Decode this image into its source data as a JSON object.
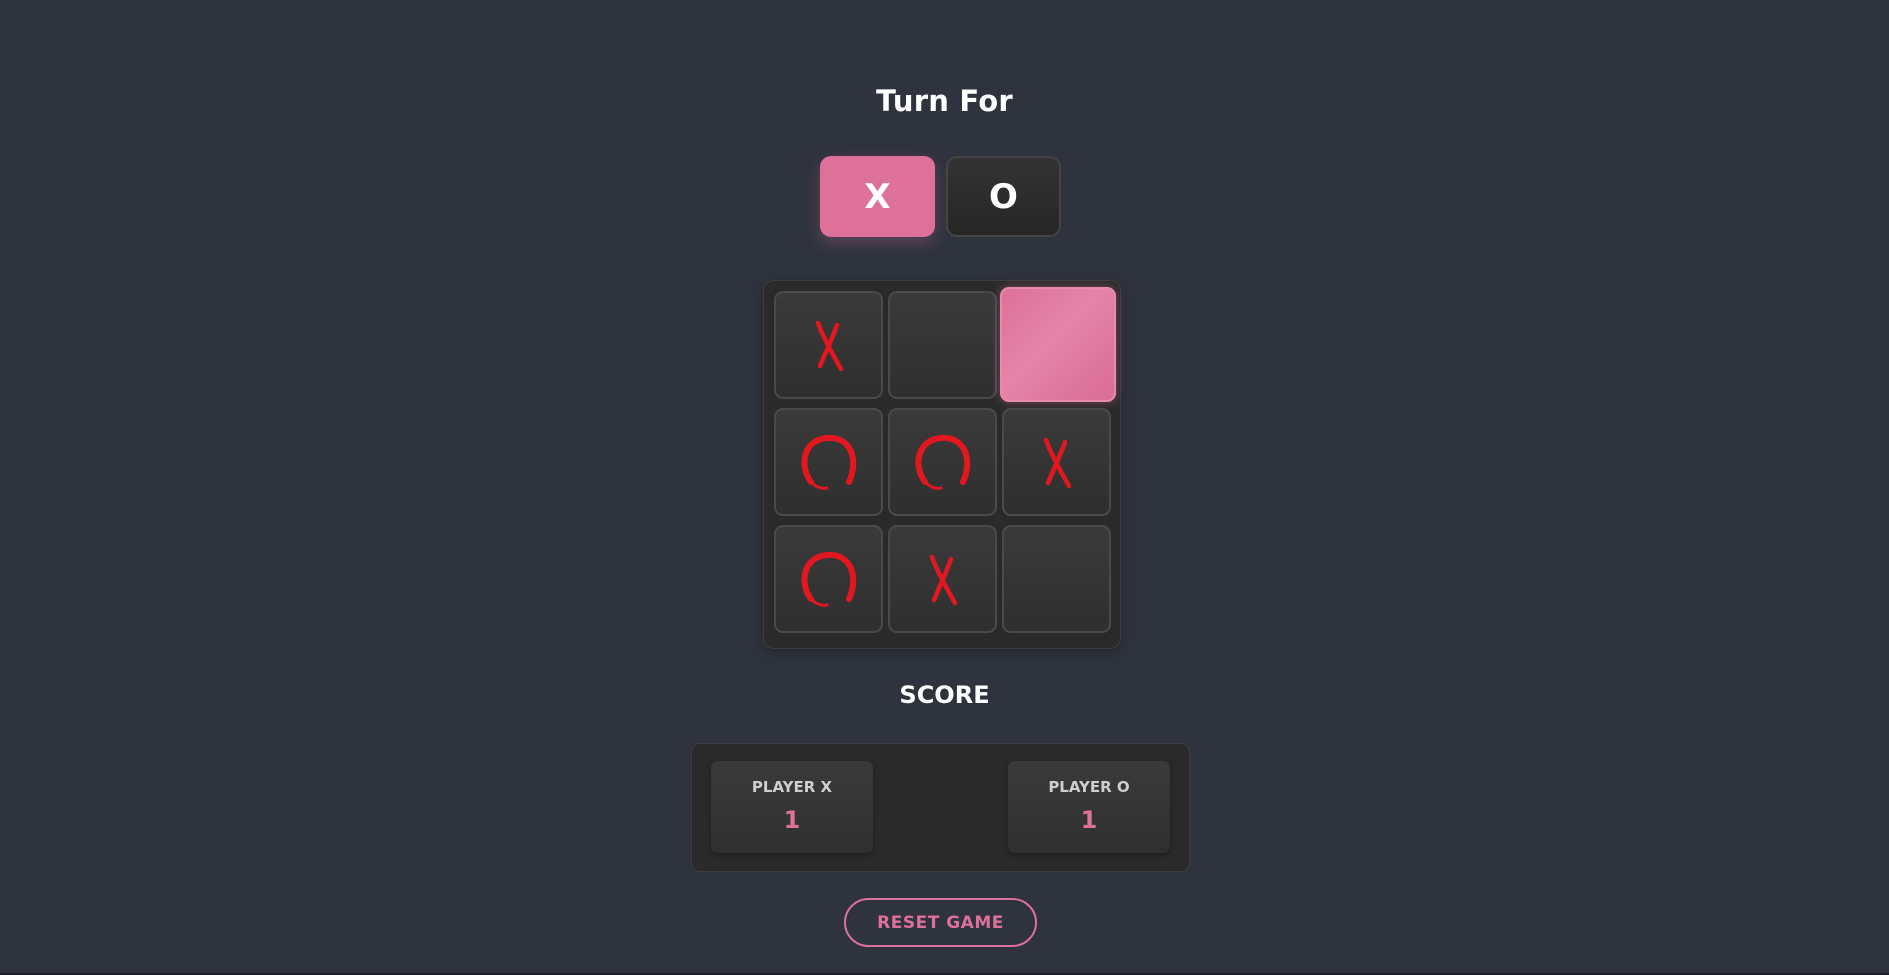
{
  "game": {
    "title": "Turn For",
    "turn_options": [
      {
        "label": "X",
        "active": true
      },
      {
        "label": "O",
        "active": false
      }
    ],
    "board": [
      "X",
      "",
      "",
      "O",
      "O",
      "X",
      "O",
      "X",
      ""
    ],
    "highlighted_cell": 2,
    "mark_color": "#e3171f",
    "accent_color": "#de7199",
    "icons": {
      "X": "hand-drawn-x-icon",
      "O": "hand-drawn-o-icon"
    }
  },
  "score": {
    "title": "SCORE",
    "players": [
      {
        "label": "PLAYER X",
        "value": "1"
      },
      {
        "label": "PLAYER O",
        "value": "1"
      }
    ]
  },
  "reset": {
    "label": "RESET GAME"
  }
}
